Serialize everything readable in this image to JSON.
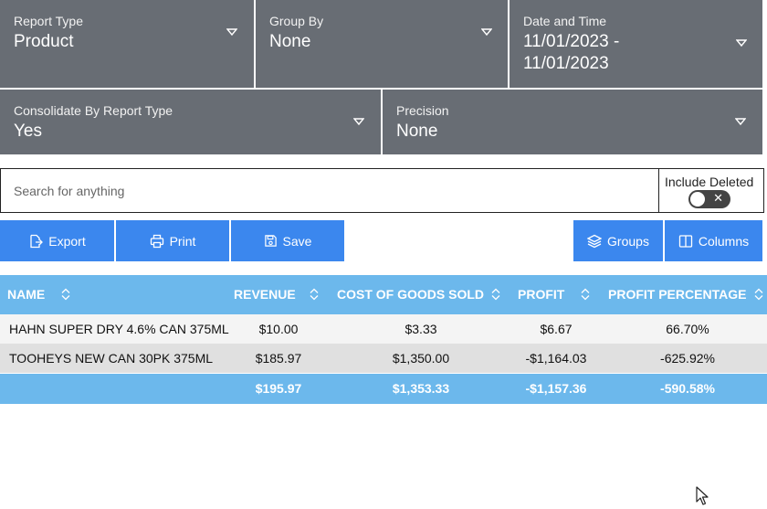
{
  "filters": {
    "report_type": {
      "label": "Report Type",
      "value": "Product"
    },
    "group_by": {
      "label": "Group By",
      "value": "None"
    },
    "date_time": {
      "label": "Date and Time",
      "value_line1": "11/01/2023 -",
      "value_line2": "11/01/2023"
    },
    "consolidate": {
      "label": "Consolidate By Report Type",
      "value": "Yes"
    },
    "precision": {
      "label": "Precision",
      "value": "None"
    }
  },
  "search": {
    "placeholder": "Search for anything",
    "value": ""
  },
  "include_deleted": {
    "label": "Include Deleted",
    "toggle_on": false
  },
  "toolbar": {
    "export_label": "Export",
    "print_label": "Print",
    "save_label": "Save",
    "groups_label": "Groups",
    "columns_label": "Columns"
  },
  "table": {
    "columns": [
      "NAME",
      "REVENUE",
      "COST OF GOODS SOLD",
      "PROFIT",
      "PROFIT PERCENTAGE"
    ],
    "rows": [
      [
        "HAHN SUPER DRY 4.6% CAN 375ML",
        "$10.00",
        "$3.33",
        "$6.67",
        "66.70%"
      ],
      [
        "TOOHEYS NEW CAN 30PK 375ML",
        "$185.97",
        "$1,350.00",
        "-$1,164.03",
        "-625.92%"
      ]
    ],
    "totals": [
      "",
      "$195.97",
      "$1,353.33",
      "-$1,157.36",
      "-590.58%"
    ]
  },
  "colors": {
    "filter_bg": "#686d74",
    "button_bg": "#3b87ee",
    "header_bg": "#6cb8ec"
  }
}
